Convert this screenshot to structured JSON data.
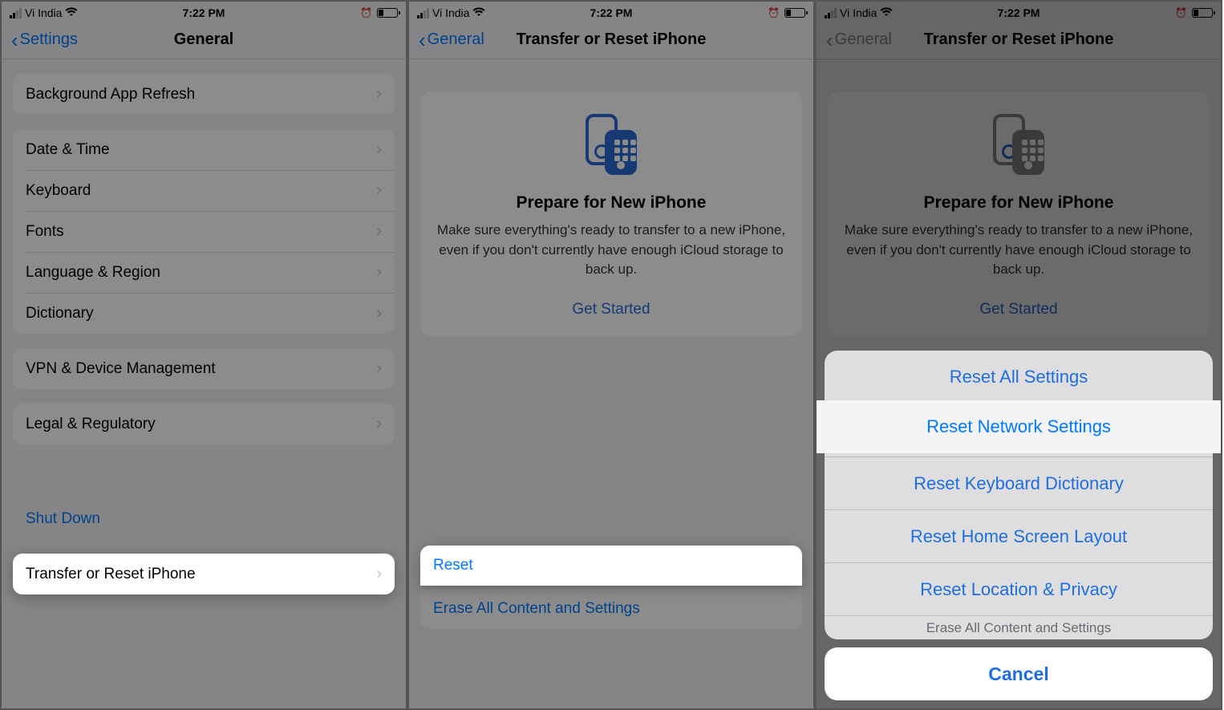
{
  "status": {
    "carrier": "Vi India",
    "time": "7:22 PM"
  },
  "screen1": {
    "back": "Settings",
    "title": "General",
    "rows": {
      "bg_refresh": "Background App Refresh",
      "date_time": "Date & Time",
      "keyboard": "Keyboard",
      "fonts": "Fonts",
      "lang_region": "Language & Region",
      "dictionary": "Dictionary",
      "vpn": "VPN & Device Management",
      "legal": "Legal & Regulatory",
      "transfer": "Transfer or Reset iPhone",
      "shutdown": "Shut Down"
    }
  },
  "screen2": {
    "back": "General",
    "title": "Transfer or Reset iPhone",
    "card_title": "Prepare for New iPhone",
    "card_body": "Make sure everything's ready to transfer to a new iPhone, even if you don't currently have enough iCloud storage to back up.",
    "card_link": "Get Started",
    "reset": "Reset",
    "erase": "Erase All Content and Settings"
  },
  "screen3": {
    "back": "General",
    "title": "Transfer or Reset iPhone",
    "card_title": "Prepare for New iPhone",
    "card_body": "Make sure everything's ready to transfer to a new iPhone, even if you don't currently have enough iCloud storage to back up.",
    "card_link": "Get Started",
    "erase_bg": "Erase All Content and Settings",
    "sheet": {
      "reset_all": "Reset All Settings",
      "reset_network": "Reset Network Settings",
      "reset_keyboard": "Reset Keyboard Dictionary",
      "reset_home": "Reset Home Screen Layout",
      "reset_location": "Reset Location & Privacy",
      "cancel": "Cancel"
    }
  }
}
